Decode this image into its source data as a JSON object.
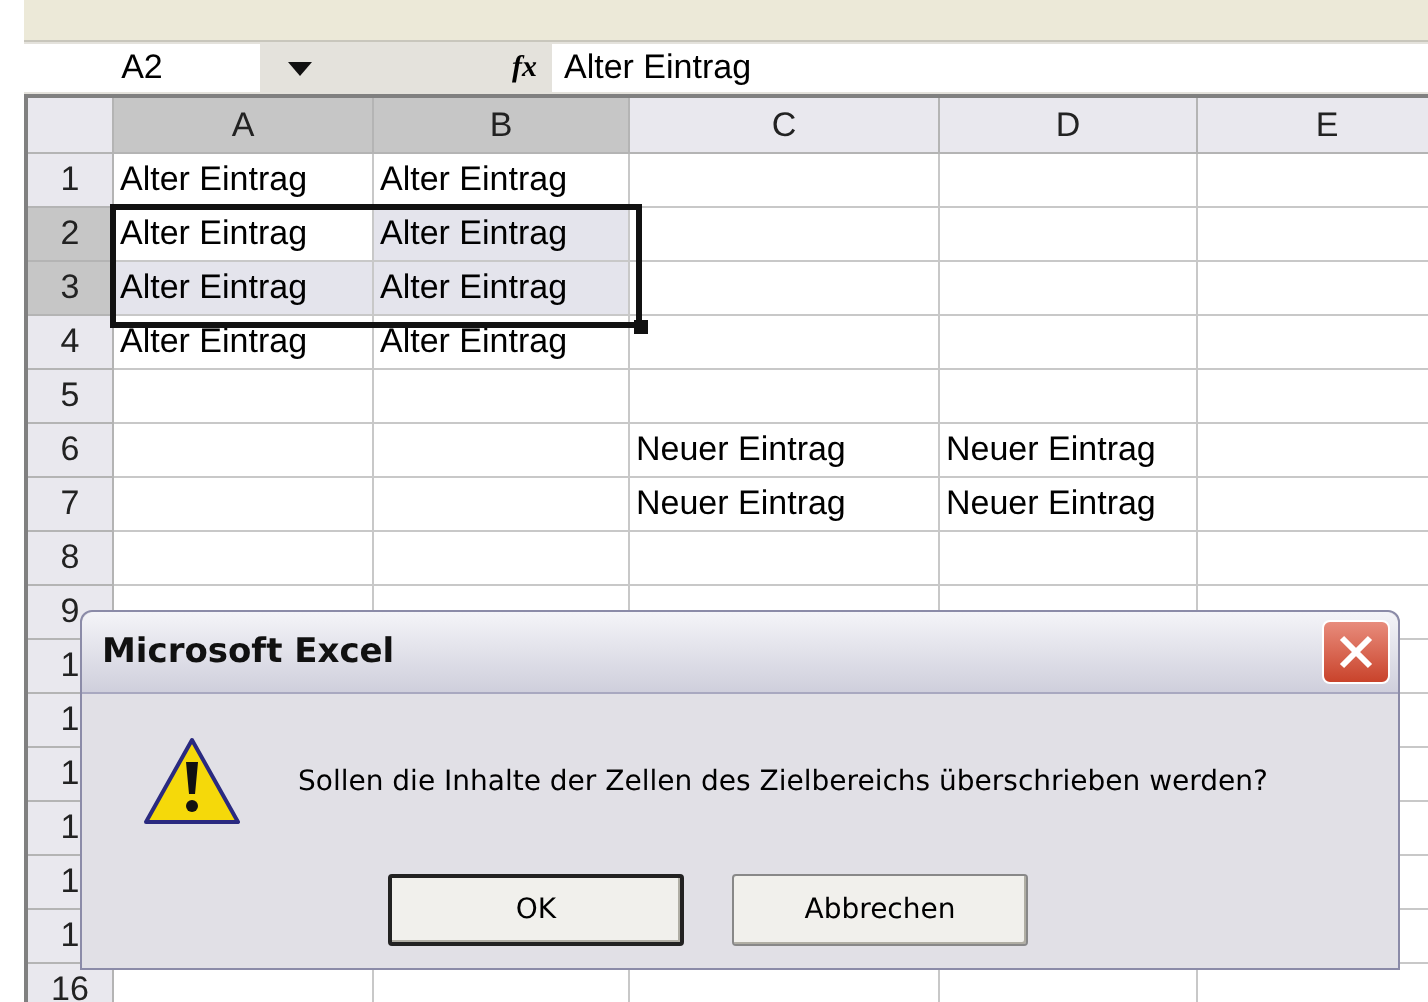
{
  "formula_bar": {
    "name_box": "A2",
    "fx": "fx",
    "formula": "Alter Eintrag"
  },
  "columns": [
    {
      "label": "A",
      "selected": true
    },
    {
      "label": "B",
      "selected": true
    },
    {
      "label": "C",
      "selected": false
    },
    {
      "label": "D",
      "selected": false
    },
    {
      "label": "E",
      "selected": false
    }
  ],
  "rows": [
    {
      "label": "1",
      "selected": false,
      "cells": [
        "Alter Eintrag",
        "Alter Eintrag",
        null,
        null,
        null
      ]
    },
    {
      "label": "2",
      "selected": true,
      "cells": [
        "Alter Eintrag",
        "Alter Eintrag",
        null,
        null,
        null
      ]
    },
    {
      "label": "3",
      "selected": true,
      "cells": [
        "Alter Eintrag",
        "Alter Eintrag",
        null,
        null,
        null
      ]
    },
    {
      "label": "4",
      "selected": false,
      "cells": [
        "Alter Eintrag",
        "Alter Eintrag",
        null,
        null,
        null
      ]
    },
    {
      "label": "5",
      "selected": false,
      "cells": [
        null,
        null,
        null,
        null,
        null
      ]
    },
    {
      "label": "6",
      "selected": false,
      "cells": [
        null,
        null,
        "Neuer Eintrag",
        "Neuer Eintrag",
        null
      ]
    },
    {
      "label": "7",
      "selected": false,
      "cells": [
        null,
        null,
        "Neuer Eintrag",
        "Neuer Eintrag",
        null
      ]
    },
    {
      "label": "8",
      "selected": false,
      "cells": [
        null,
        null,
        null,
        null,
        null
      ]
    },
    {
      "label": "9",
      "selected": false,
      "cells": [
        null,
        null,
        null,
        null,
        null
      ]
    },
    {
      "label": "1",
      "selected": false,
      "cells": [
        null,
        null,
        null,
        null,
        null
      ]
    },
    {
      "label": "1",
      "selected": false,
      "cells": [
        null,
        null,
        null,
        null,
        null
      ]
    },
    {
      "label": "1",
      "selected": false,
      "cells": [
        null,
        null,
        null,
        null,
        null
      ]
    },
    {
      "label": "1",
      "selected": false,
      "cells": [
        null,
        null,
        null,
        null,
        null
      ]
    },
    {
      "label": "1",
      "selected": false,
      "cells": [
        null,
        null,
        null,
        null,
        null
      ]
    },
    {
      "label": "1",
      "selected": false,
      "cells": [
        null,
        null,
        null,
        null,
        null
      ]
    },
    {
      "label": "16",
      "selected": false,
      "cells": [
        null,
        null,
        null,
        null,
        null
      ]
    }
  ],
  "dialog": {
    "title": "Microsoft Excel",
    "message": "Sollen die Inhalte der Zellen des Zielbereichs überschrieben werden?",
    "buttons": [
      {
        "label": "OK",
        "default": true
      },
      {
        "label": "Abbrechen",
        "default": false
      }
    ]
  }
}
